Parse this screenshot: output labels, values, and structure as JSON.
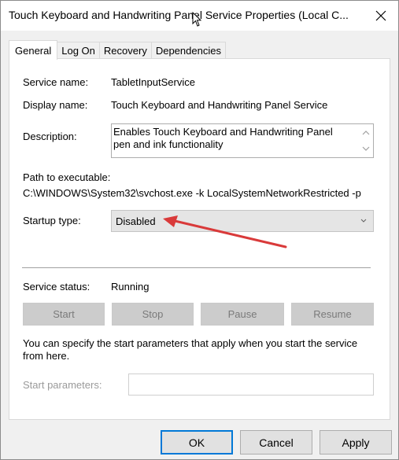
{
  "window": {
    "title": "Touch Keyboard and Handwriting Panel Service Properties (Local C...",
    "close_icon": "close-icon"
  },
  "tabs": [
    {
      "label": "General",
      "active": true
    },
    {
      "label": "Log On",
      "active": false
    },
    {
      "label": "Recovery",
      "active": false
    },
    {
      "label": "Dependencies",
      "active": false
    }
  ],
  "general": {
    "service_name_label": "Service name:",
    "service_name": "TabletInputService",
    "display_name_label": "Display name:",
    "display_name": "Touch Keyboard and Handwriting Panel Service",
    "description_label": "Description:",
    "description": "Enables Touch Keyboard and Handwriting Panel pen and ink functionality",
    "path_label": "Path to executable:",
    "path": "C:\\WINDOWS\\System32\\svchost.exe -k LocalSystemNetworkRestricted -p",
    "startup_type_label": "Startup type:",
    "startup_type": "Disabled",
    "service_status_label": "Service status:",
    "service_status": "Running",
    "buttons": {
      "start": "Start",
      "stop": "Stop",
      "pause": "Pause",
      "resume": "Resume"
    },
    "info_text": "You can specify the start parameters that apply when you start the service from here.",
    "start_params_label": "Start parameters:",
    "start_params_value": ""
  },
  "dialog_buttons": {
    "ok": "OK",
    "cancel": "Cancel",
    "apply": "Apply"
  },
  "colors": {
    "annotation_arrow": "#d93a3a",
    "default_button_border": "#0078d7"
  }
}
